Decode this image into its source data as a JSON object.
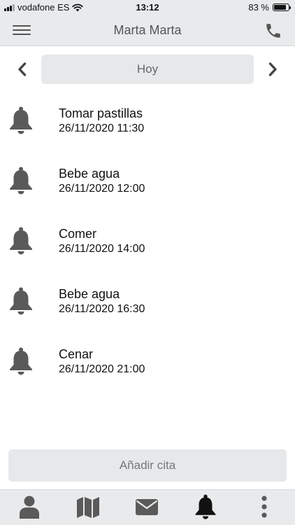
{
  "status_bar": {
    "carrier": "vodafone ES",
    "time": "13:12",
    "battery_text": "83 %",
    "battery_level": 0.83
  },
  "nav": {
    "title": "Marta Marta",
    "menu_icon": "hamburger-menu-icon",
    "call_icon": "phone-icon"
  },
  "date_selector": {
    "label": "Hoy",
    "prev_icon": "chevron-left-icon",
    "next_icon": "chevron-right-icon"
  },
  "reminders": [
    {
      "title": "Tomar pastillas",
      "datetime": "26/11/2020 11:30",
      "icon": "bell-icon"
    },
    {
      "title": "Bebe agua",
      "datetime": "26/11/2020 12:00",
      "icon": "bell-icon"
    },
    {
      "title": "Comer",
      "datetime": "26/11/2020 14:00",
      "icon": "bell-icon"
    },
    {
      "title": "Bebe agua",
      "datetime": "26/11/2020 16:30",
      "icon": "bell-icon"
    },
    {
      "title": "Cenar",
      "datetime": "26/11/2020 21:00",
      "icon": "bell-icon"
    }
  ],
  "add_button": {
    "label": "Añadir cita"
  },
  "tab_bar": {
    "tabs": [
      {
        "icon": "person-icon",
        "active": false
      },
      {
        "icon": "map-icon",
        "active": false
      },
      {
        "icon": "envelope-icon",
        "active": false
      },
      {
        "icon": "bell-icon",
        "active": true
      },
      {
        "icon": "more-vertical-icon",
        "active": false
      }
    ]
  },
  "colors": {
    "bar_background": "#e8eaec",
    "icon_gray": "#5a5a5a",
    "active_tab": "#111111"
  }
}
